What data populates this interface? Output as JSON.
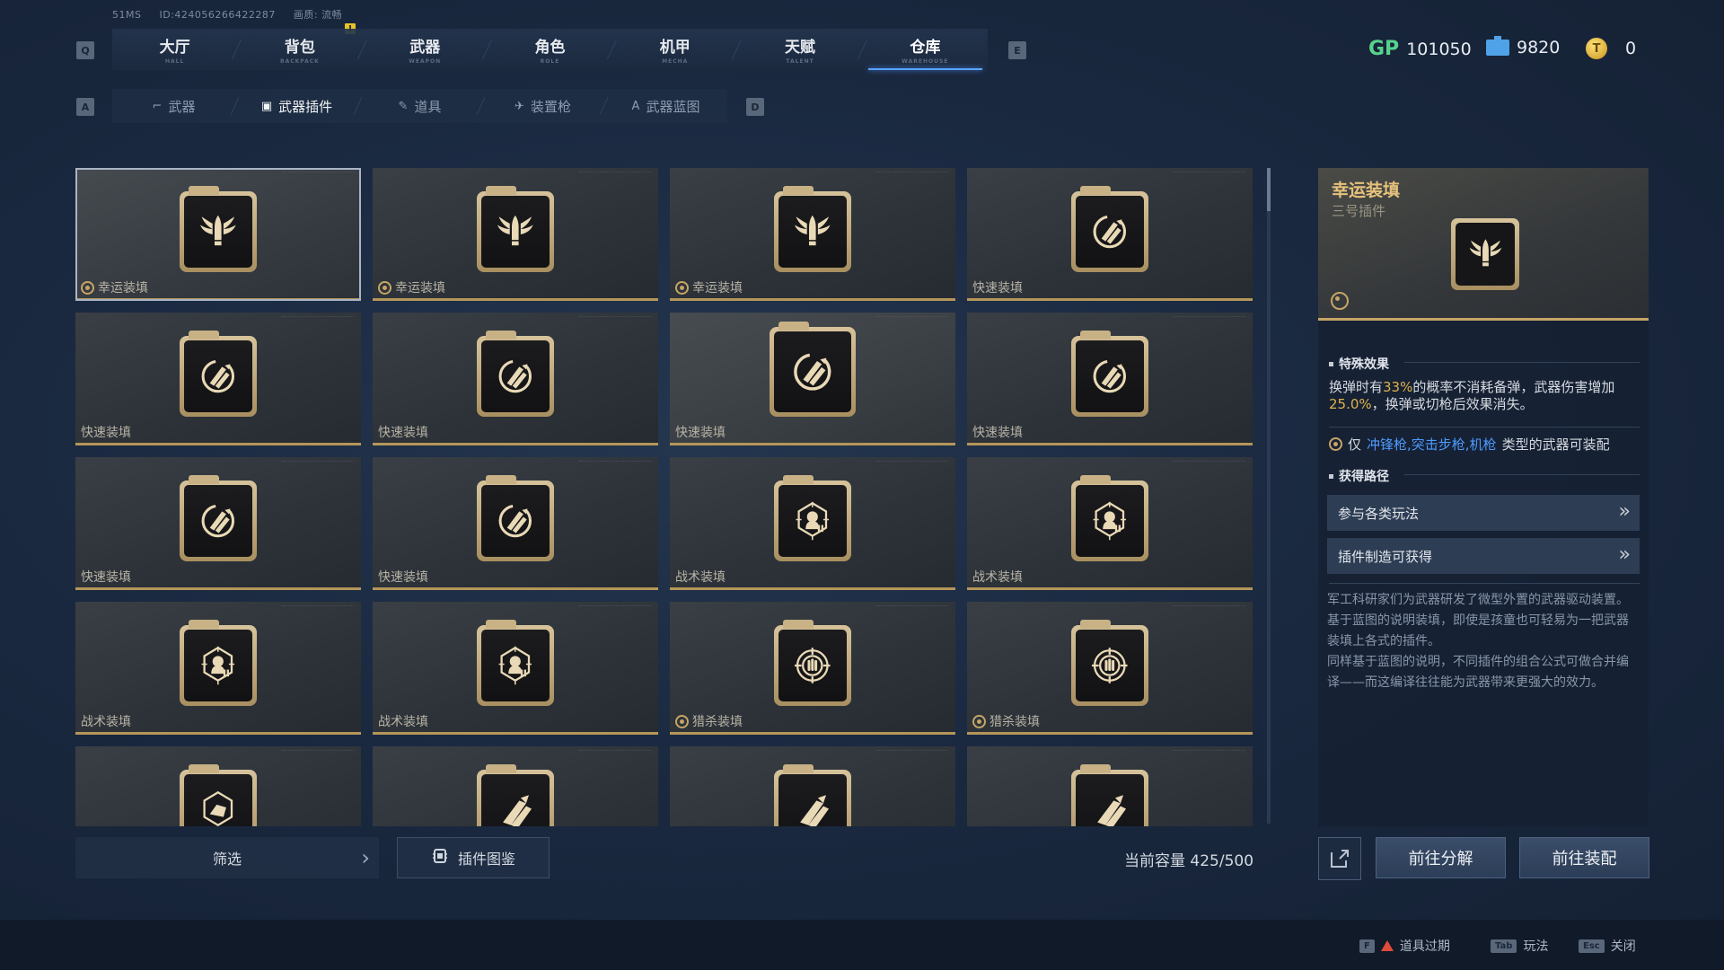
{
  "top_info": {
    "ms": "51MS",
    "id": "ID:424056266422287",
    "quality": "画质: 流畅"
  },
  "keys": {
    "left_main": "Q",
    "right_main": "E",
    "left_sub": "A",
    "right_sub": "D"
  },
  "notice_badge": "!",
  "main_tabs": [
    {
      "label": "大厅",
      "sub": "HALL"
    },
    {
      "label": "背包",
      "sub": "BACKPACK"
    },
    {
      "label": "武器",
      "sub": "WEAPON"
    },
    {
      "label": "角色",
      "sub": "ROLE"
    },
    {
      "label": "机甲",
      "sub": "MECHA"
    },
    {
      "label": "天赋",
      "sub": "TALENT"
    },
    {
      "label": "仓库",
      "sub": "WAREHOUSE"
    }
  ],
  "currency": {
    "gp_icon": "GP",
    "gp": "101050",
    "tickets": "9820",
    "coins": "0",
    "coin_icon": "T"
  },
  "sub_tabs": [
    {
      "label": "武器",
      "icon": "rifle-icon"
    },
    {
      "label": "武器插件",
      "icon": "chip-icon"
    },
    {
      "label": "道具",
      "icon": "item-icon"
    },
    {
      "label": "装置枪",
      "icon": "device-gun-icon"
    },
    {
      "label": "武器蓝图",
      "icon": "blueprint-icon"
    }
  ],
  "plugins": [
    {
      "name": "幸运装填",
      "icon": "bullet-wings-icon",
      "badge": true
    },
    {
      "name": "幸运装填",
      "icon": "bullet-wings-icon",
      "badge": true
    },
    {
      "name": "幸运装填",
      "icon": "bullet-wings-icon",
      "badge": true
    },
    {
      "name": "快速装填",
      "icon": "fast-reload-icon",
      "badge": false
    },
    {
      "name": "快速装填",
      "icon": "fast-reload-icon",
      "badge": false
    },
    {
      "name": "快速装填",
      "icon": "fast-reload-icon",
      "badge": false
    },
    {
      "name": "快速装填",
      "icon": "fast-reload-icon",
      "badge": false
    },
    {
      "name": "快速装填",
      "icon": "fast-reload-icon",
      "badge": false
    },
    {
      "name": "快速装填",
      "icon": "fast-reload-icon",
      "badge": false
    },
    {
      "name": "快速装填",
      "icon": "fast-reload-icon",
      "badge": false
    },
    {
      "name": "战术装填",
      "icon": "tactical-reload-icon",
      "badge": false
    },
    {
      "name": "战术装填",
      "icon": "tactical-reload-icon",
      "badge": false
    },
    {
      "name": "战术装填",
      "icon": "tactical-reload-icon",
      "badge": false
    },
    {
      "name": "战术装填",
      "icon": "tactical-reload-icon",
      "badge": false
    },
    {
      "name": "猎杀装填",
      "icon": "hunt-reload-icon",
      "badge": true
    },
    {
      "name": "猎杀装填",
      "icon": "hunt-reload-icon",
      "badge": true
    },
    {
      "name": "",
      "icon": "hand-reload-icon",
      "badge": false
    },
    {
      "name": "",
      "icon": "rocket-icon",
      "badge": false
    },
    {
      "name": "",
      "icon": "rocket-icon",
      "badge": false
    },
    {
      "name": "",
      "icon": "rocket-icon",
      "badge": false
    }
  ],
  "bottom": {
    "filter": "筛选",
    "atlas": "插件图鉴",
    "capacity_label": "当前容量",
    "capacity": "425/500"
  },
  "detail": {
    "title": "幸运装填",
    "subtitle": "三号插件",
    "effect_heading": "特殊效果",
    "effect_pre": "换弹时有",
    "effect_pct1": "33%",
    "effect_mid": "的概率不消耗备弹，武器伤害增加",
    "effect_pct2": "25.0%",
    "effect_post": "，换弹或切枪后效果消失。",
    "restrict_pre": "仅",
    "restrict_types": "冲锋枪,突击步枪,机枪",
    "restrict_post": "类型的武器可装配",
    "source_heading": "获得路径",
    "sources": [
      "参与各类玩法",
      "插件制造可获得"
    ],
    "lore": "军工科研家们为武器研发了微型外置的武器驱动装置。\n基于蓝图的说明装填，即使是孩童也可轻易为一把武器装填上各式的插件。\n同样基于蓝图的说明，不同插件的组合公式可做合并编译——而这编译往往能为武器带来更强大的效力。"
  },
  "actions": {
    "disassemble": "前往分解",
    "equip": "前往装配"
  },
  "footer": [
    {
      "key": "F",
      "label": "道具过期"
    },
    {
      "key": "Tab",
      "label": "玩法"
    },
    {
      "key": "Esc",
      "label": "关闭"
    }
  ],
  "colors": {
    "accent_gold": "#c6a566",
    "accent_blue": "#4d9bff",
    "highlight": "#e0b24c",
    "gp_green": "#57d28c"
  }
}
